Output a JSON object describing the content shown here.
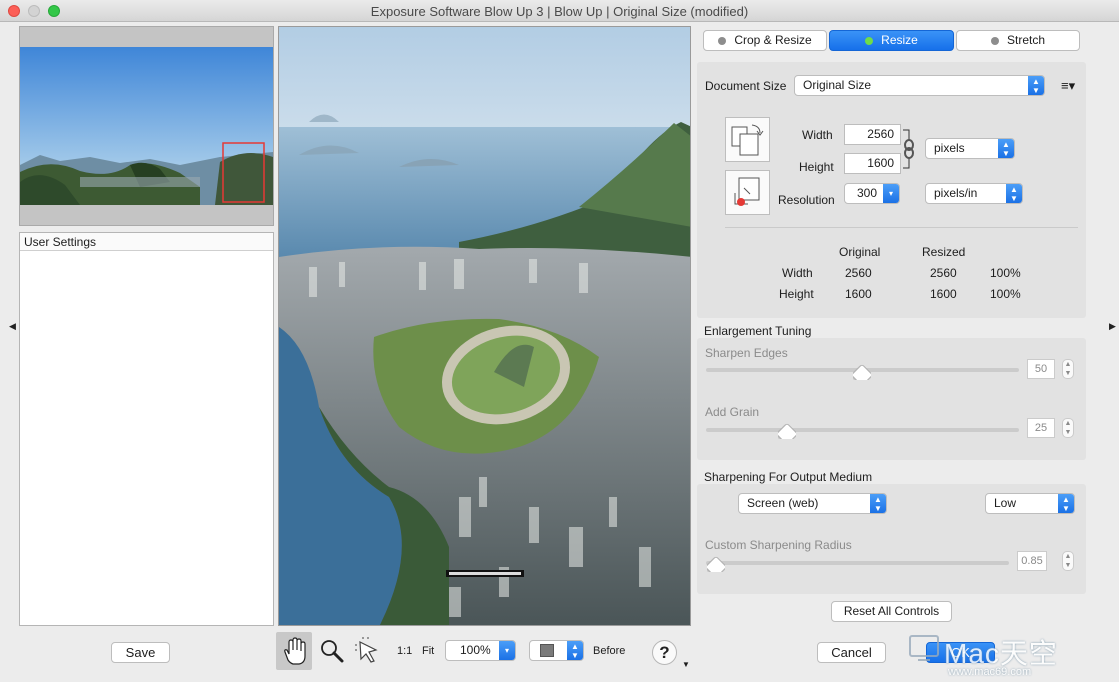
{
  "window": {
    "title": "Exposure Software Blow Up 3 | Blow Up | Original Size (modified)"
  },
  "left_panel": {
    "user_settings_label": "User Settings",
    "save_label": "Save"
  },
  "tabs": [
    {
      "label": "Crop & Resize",
      "active": false
    },
    {
      "label": "Resize",
      "active": true
    },
    {
      "label": "Stretch",
      "active": false
    }
  ],
  "document_size": {
    "label": "Document Size",
    "selected": "Original Size",
    "width_label": "Width",
    "width_value": "2560",
    "height_label": "Height",
    "height_value": "1600",
    "resolution_label": "Resolution",
    "resolution_value": "300",
    "size_unit": "pixels",
    "resolution_unit": "pixels/in"
  },
  "stats": {
    "col_original": "Original",
    "col_resized": "Resized",
    "rows": [
      {
        "label": "Width",
        "original": "2560",
        "resized": "2560",
        "percent": "100%"
      },
      {
        "label": "Height",
        "original": "1600",
        "resized": "1600",
        "percent": "100%"
      }
    ]
  },
  "enlargement": {
    "title": "Enlargement Tuning",
    "sharpen_edges_label": "Sharpen Edges",
    "sharpen_edges_value": "50",
    "sharpen_edges_fraction": 0.5,
    "add_grain_label": "Add Grain",
    "add_grain_value": "25",
    "add_grain_fraction": 0.25
  },
  "sharpening": {
    "title": "Sharpening For Output Medium",
    "medium": "Screen (web)",
    "strength": "Low",
    "radius_label": "Custom Sharpening Radius",
    "radius_value": "0.85"
  },
  "buttons": {
    "reset": "Reset All Controls",
    "cancel": "Cancel",
    "ok": "OK"
  },
  "toolbar": {
    "one_to_one": "1:1",
    "fit": "Fit",
    "zoom": "100%",
    "before": "Before",
    "help": "?"
  },
  "watermark": {
    "brand": "Mac天空",
    "url": "www.mac69.com"
  },
  "colors": {
    "accent": "#1670ea",
    "tab_dot_active": "#6fdc4a"
  }
}
